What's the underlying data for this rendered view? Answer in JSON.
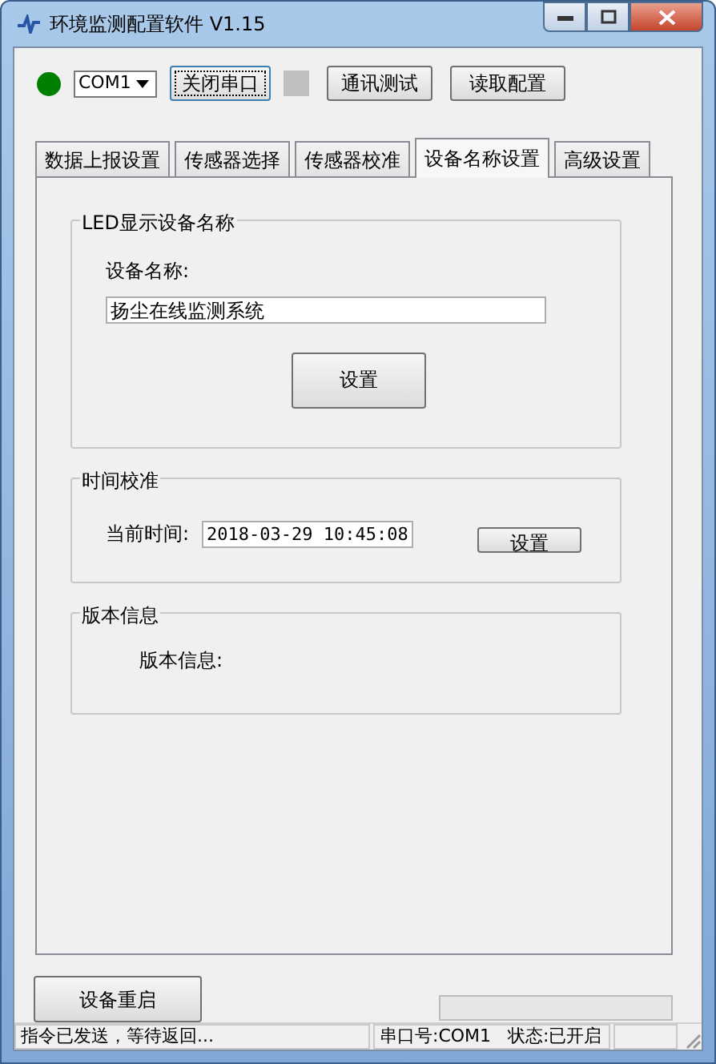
{
  "window": {
    "title": "环境监测配置软件 V1.15"
  },
  "toolbar": {
    "port_led": {
      "on": true
    },
    "port_select": {
      "value": "COM1"
    },
    "comm_led": {
      "on": false
    },
    "buttons": [
      {
        "label": "关闭串口",
        "focused": true
      },
      {
        "label": "通讯测试",
        "focused": false
      },
      {
        "label": "读取配置",
        "focused": false
      }
    ]
  },
  "tabs": [
    {
      "label": "数据上报设置",
      "selected": false
    },
    {
      "label": "传感器选择",
      "selected": false
    },
    {
      "label": "传感器校准",
      "selected": false
    },
    {
      "label": "设备名称设置",
      "selected": true
    },
    {
      "label": "高级设置",
      "selected": false
    }
  ],
  "led_group": {
    "title": "LED显示设备名称",
    "label": "设备名称:",
    "value": "扬尘在线监测系统",
    "button": "设置"
  },
  "time_group": {
    "title": "时间校准",
    "label": "当前时间:",
    "value": "2018-03-29 10:45:08",
    "button": "设置"
  },
  "version_group": {
    "title": "版本信息",
    "label": "版本信息:"
  },
  "restart_button": "设备重启",
  "progress": {
    "level": 0
  },
  "status_bar": [
    "指令已发送，等待返回...",
    "串口号:COM1   状态:已开启"
  ]
}
